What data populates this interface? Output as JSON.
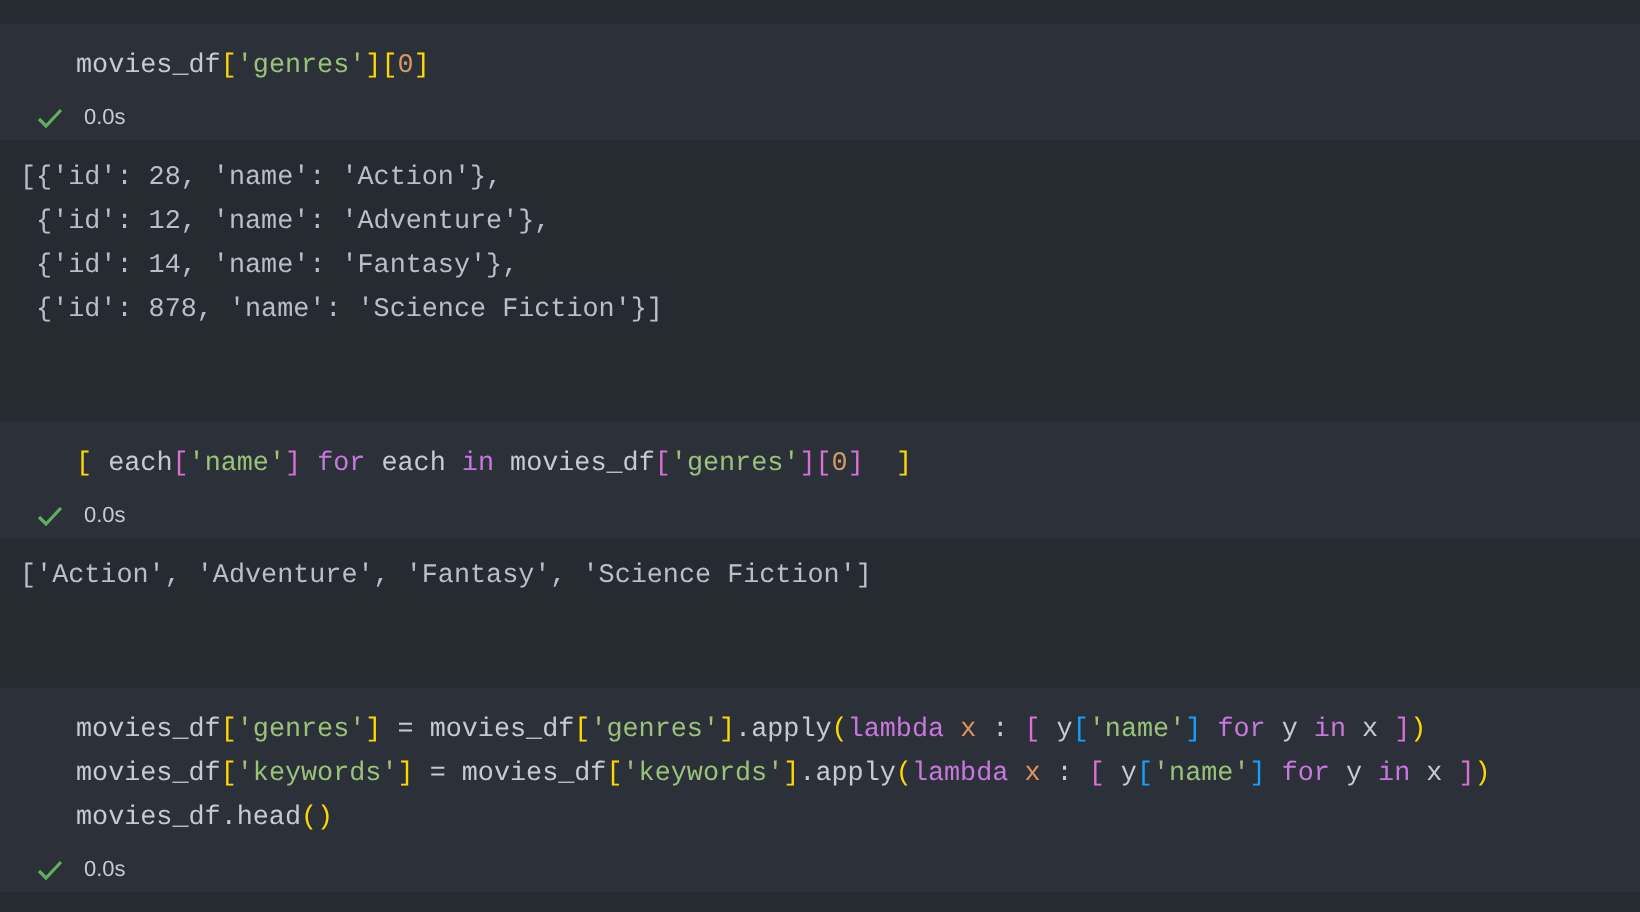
{
  "cells": [
    {
      "input": [
        [
          {
            "text": "movies_df",
            "kind": "plain"
          },
          {
            "text": "[",
            "kind": "bracket1"
          },
          {
            "text": "'genres'",
            "kind": "string"
          },
          {
            "text": "]",
            "kind": "bracket1"
          },
          {
            "text": "[",
            "kind": "bracket1"
          },
          {
            "text": "0",
            "kind": "number"
          },
          {
            "text": "]",
            "kind": "bracket1"
          }
        ]
      ],
      "time": "0.0s",
      "output": [
        "[{'id': 28, 'name': 'Action'},",
        " {'id': 12, 'name': 'Adventure'},",
        " {'id': 14, 'name': 'Fantasy'},",
        " {'id': 878, 'name': 'Science Fiction'}]"
      ]
    },
    {
      "input": [
        [
          {
            "text": "[",
            "kind": "bracket1"
          },
          {
            "text": " each",
            "kind": "plain"
          },
          {
            "text": "[",
            "kind": "bracket2"
          },
          {
            "text": "'name'",
            "kind": "string"
          },
          {
            "text": "]",
            "kind": "bracket2"
          },
          {
            "text": " for",
            "kind": "keyword"
          },
          {
            "text": " each ",
            "kind": "plain"
          },
          {
            "text": "in",
            "kind": "keyword"
          },
          {
            "text": " movies_df",
            "kind": "plain"
          },
          {
            "text": "[",
            "kind": "bracket2"
          },
          {
            "text": "'genres'",
            "kind": "string"
          },
          {
            "text": "]",
            "kind": "bracket2"
          },
          {
            "text": "[",
            "kind": "bracket2"
          },
          {
            "text": "0",
            "kind": "number"
          },
          {
            "text": "]",
            "kind": "bracket2"
          },
          {
            "text": "  ]",
            "kind": "bracket1"
          }
        ]
      ],
      "time": "0.0s",
      "output": [
        "['Action', 'Adventure', 'Fantasy', 'Science Fiction']"
      ]
    },
    {
      "input": [
        [
          {
            "text": "movies_df",
            "kind": "plain"
          },
          {
            "text": "[",
            "kind": "bracket1"
          },
          {
            "text": "'genres'",
            "kind": "string"
          },
          {
            "text": "]",
            "kind": "bracket1"
          },
          {
            "text": " = movies_df",
            "kind": "plain"
          },
          {
            "text": "[",
            "kind": "bracket1"
          },
          {
            "text": "'genres'",
            "kind": "string"
          },
          {
            "text": "]",
            "kind": "bracket1"
          },
          {
            "text": ".apply",
            "kind": "plain"
          },
          {
            "text": "(",
            "kind": "bracket1"
          },
          {
            "text": "lambda",
            "kind": "keyword"
          },
          {
            "text": " x",
            "kind": "param"
          },
          {
            "text": " : ",
            "kind": "plain"
          },
          {
            "text": "[",
            "kind": "bracket2"
          },
          {
            "text": " y",
            "kind": "plain"
          },
          {
            "text": "[",
            "kind": "bracket3"
          },
          {
            "text": "'name'",
            "kind": "string"
          },
          {
            "text": "]",
            "kind": "bracket3"
          },
          {
            "text": " for",
            "kind": "keyword"
          },
          {
            "text": " y ",
            "kind": "plain"
          },
          {
            "text": "in",
            "kind": "keyword"
          },
          {
            "text": " x ",
            "kind": "plain"
          },
          {
            "text": "]",
            "kind": "bracket2"
          },
          {
            "text": ")",
            "kind": "bracket1"
          }
        ],
        [
          {
            "text": "movies_df",
            "kind": "plain"
          },
          {
            "text": "[",
            "kind": "bracket1"
          },
          {
            "text": "'keywords'",
            "kind": "string"
          },
          {
            "text": "]",
            "kind": "bracket1"
          },
          {
            "text": " = movies_df",
            "kind": "plain"
          },
          {
            "text": "[",
            "kind": "bracket1"
          },
          {
            "text": "'keywords'",
            "kind": "string"
          },
          {
            "text": "]",
            "kind": "bracket1"
          },
          {
            "text": ".apply",
            "kind": "plain"
          },
          {
            "text": "(",
            "kind": "bracket1"
          },
          {
            "text": "lambda",
            "kind": "keyword"
          },
          {
            "text": " x",
            "kind": "param"
          },
          {
            "text": " : ",
            "kind": "plain"
          },
          {
            "text": "[",
            "kind": "bracket2"
          },
          {
            "text": " y",
            "kind": "plain"
          },
          {
            "text": "[",
            "kind": "bracket3"
          },
          {
            "text": "'name'",
            "kind": "string"
          },
          {
            "text": "]",
            "kind": "bracket3"
          },
          {
            "text": " for",
            "kind": "keyword"
          },
          {
            "text": " y ",
            "kind": "plain"
          },
          {
            "text": "in",
            "kind": "keyword"
          },
          {
            "text": " x ",
            "kind": "plain"
          },
          {
            "text": "]",
            "kind": "bracket2"
          },
          {
            "text": ")",
            "kind": "bracket1"
          }
        ],
        [
          {
            "text": "movies_df.head",
            "kind": "plain"
          },
          {
            "text": "()",
            "kind": "bracket1"
          }
        ]
      ],
      "time": "0.0s"
    }
  ]
}
